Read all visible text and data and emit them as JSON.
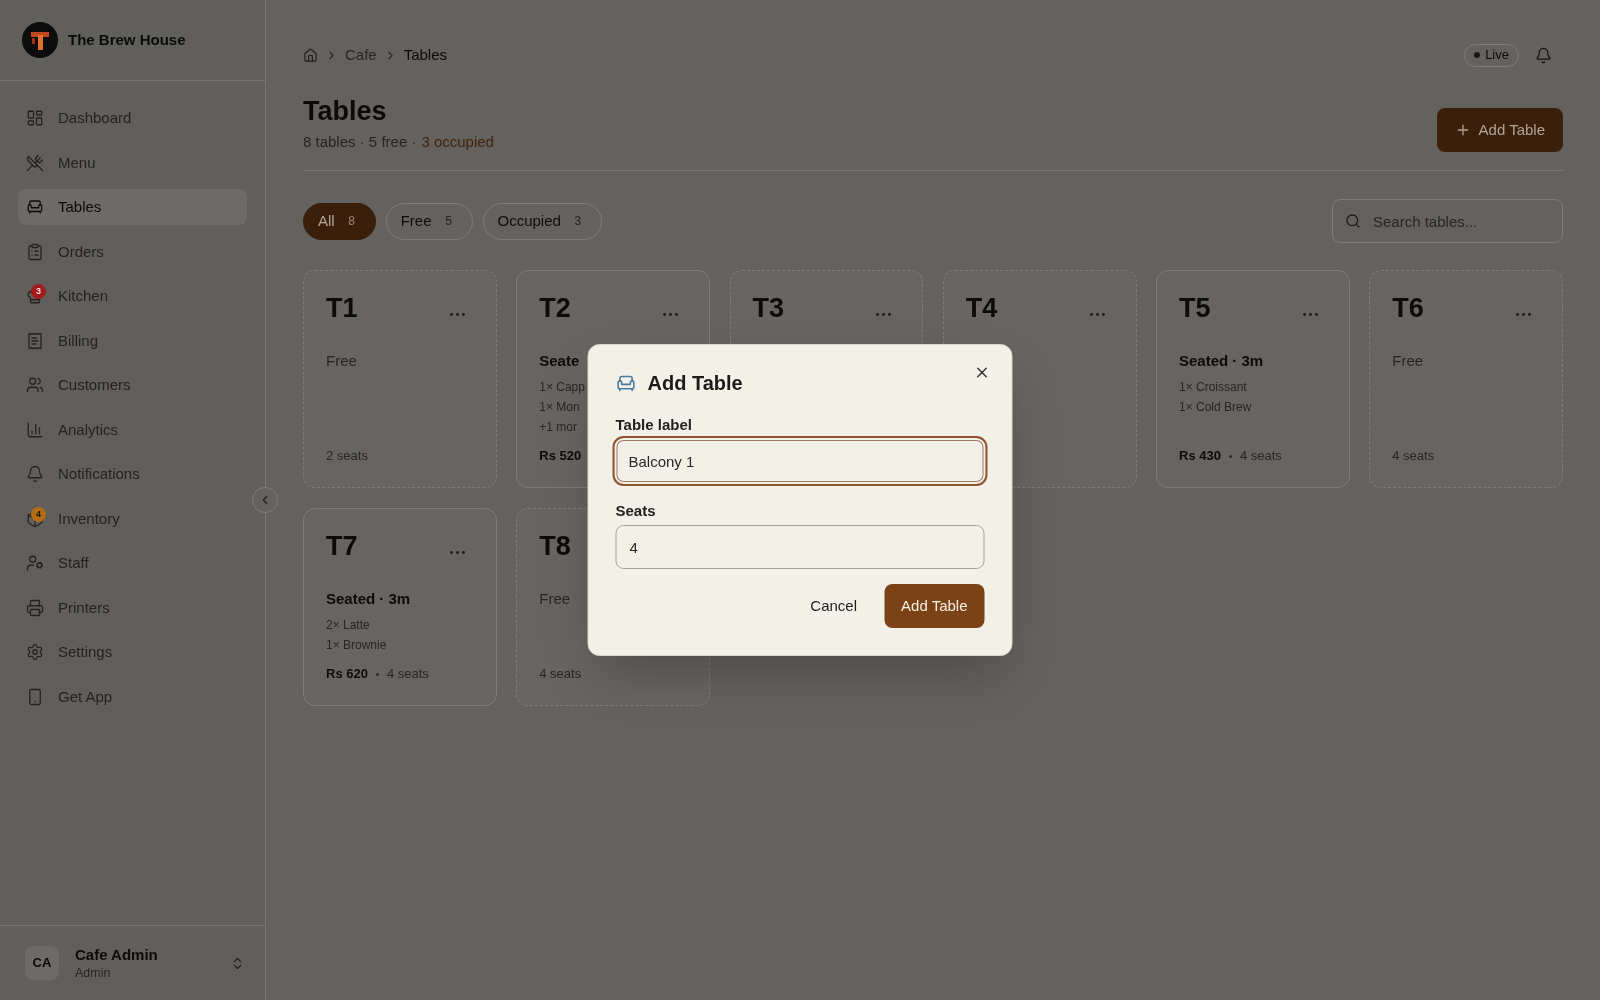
{
  "sidebar": {
    "brand": {
      "name": "The Brew House"
    },
    "items": [
      {
        "label": "Dashboard",
        "selected": false
      },
      {
        "label": "Menu",
        "selected": false
      },
      {
        "label": "Tables",
        "selected": true
      },
      {
        "label": "Orders",
        "selected": false
      },
      {
        "label": "Kitchen",
        "selected": false,
        "badge": {
          "count": "3",
          "color": "#a31a1a"
        }
      },
      {
        "label": "Billing",
        "selected": false
      },
      {
        "label": "Customers",
        "selected": false
      },
      {
        "label": "Analytics",
        "selected": false
      },
      {
        "label": "Notifications",
        "selected": false
      },
      {
        "label": "Inventory",
        "selected": false,
        "badge": {
          "count": "4",
          "color": "#b36c12"
        }
      },
      {
        "label": "Staff",
        "selected": false
      },
      {
        "label": "Printers",
        "selected": false
      },
      {
        "label": "Settings",
        "selected": false
      },
      {
        "label": "Get App",
        "selected": false
      }
    ],
    "user": {
      "initials": "CA",
      "name": "Cafe Admin",
      "role": "Admin"
    }
  },
  "breadcrumb": {
    "trail": [
      "Cafe"
    ],
    "current": "Tables"
  },
  "status_pill": {
    "label": "Live"
  },
  "header": {
    "title": "Tables",
    "summary": "8 tables · 5 free ·",
    "summary_highlight": "3 occupied",
    "add_button": "Add Table"
  },
  "filters": [
    {
      "label": "All",
      "count": "8",
      "selected": true
    },
    {
      "label": "Free",
      "count": "5",
      "selected": false
    },
    {
      "label": "Occupied",
      "count": "3",
      "selected": false
    }
  ],
  "search": {
    "placeholder": "Search tables..."
  },
  "tables": [
    {
      "label": "T1",
      "kind": "free",
      "status": "Free",
      "seats": "2 seats"
    },
    {
      "label": "T2",
      "kind": "occupied",
      "status": "Seate",
      "items": [
        "1× Capp",
        "1× Mon",
        "+1 mor"
      ],
      "price": "Rs 520"
    },
    {
      "label": "T3",
      "kind": "free"
    },
    {
      "label": "T4",
      "kind": "free"
    },
    {
      "label": "T5",
      "kind": "occupied",
      "status": "Seated · 3m",
      "items": [
        "1× Croissant",
        "1× Cold Brew"
      ],
      "price": "Rs 430",
      "seats": "4 seats"
    },
    {
      "label": "T6",
      "kind": "free",
      "status": "Free",
      "seats": "4 seats"
    },
    {
      "label": "T7",
      "kind": "occupied",
      "status": "Seated · 3m",
      "items": [
        "2× Latte",
        "1× Brownie"
      ],
      "price": "Rs 620",
      "seats": "4 seats"
    },
    {
      "label": "T8",
      "kind": "free",
      "status": "Free",
      "seats": "4 seats"
    }
  ],
  "dialog": {
    "title": "Add Table",
    "fields": [
      {
        "label": "Table label",
        "value": "Balcony 1",
        "focused": true
      },
      {
        "label": "Seats",
        "value": "4",
        "focused": false
      }
    ],
    "buttons": [
      {
        "label": "Cancel",
        "kind": "secondary"
      },
      {
        "label": "Add Table",
        "kind": "primary"
      }
    ]
  }
}
